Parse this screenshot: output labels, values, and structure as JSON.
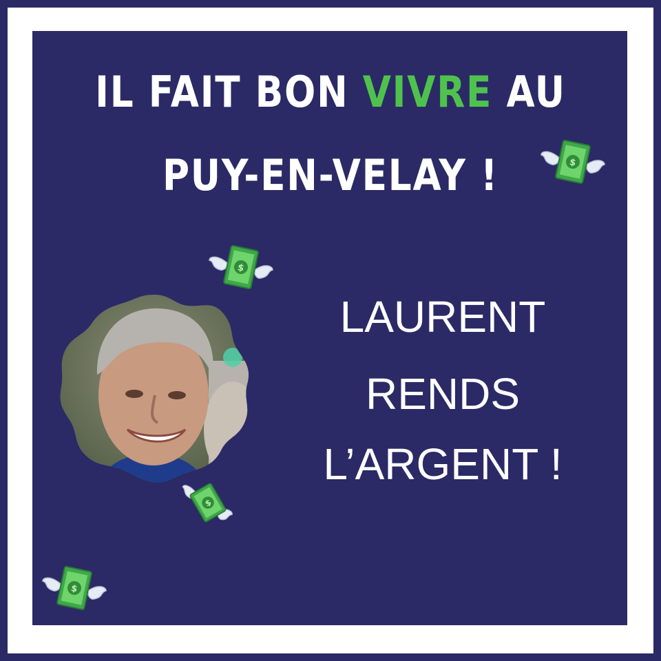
{
  "colors": {
    "background": "#2b2a66",
    "frame": "#ffffff",
    "accent": "#4fc24d",
    "text": "#ffffff"
  },
  "headline": {
    "line1_before": "IL FAIT BON ",
    "line1_accent": "VIVRE",
    "line1_after": " AU",
    "line2": "PUY-EN-VELAY !"
  },
  "slogan": {
    "line1": "LAURENT",
    "line2": "RENDS",
    "line3": "L’ARGENT !"
  },
  "icons": {
    "photo": "smiling-man-portrait",
    "money": "flying-money-icon"
  }
}
